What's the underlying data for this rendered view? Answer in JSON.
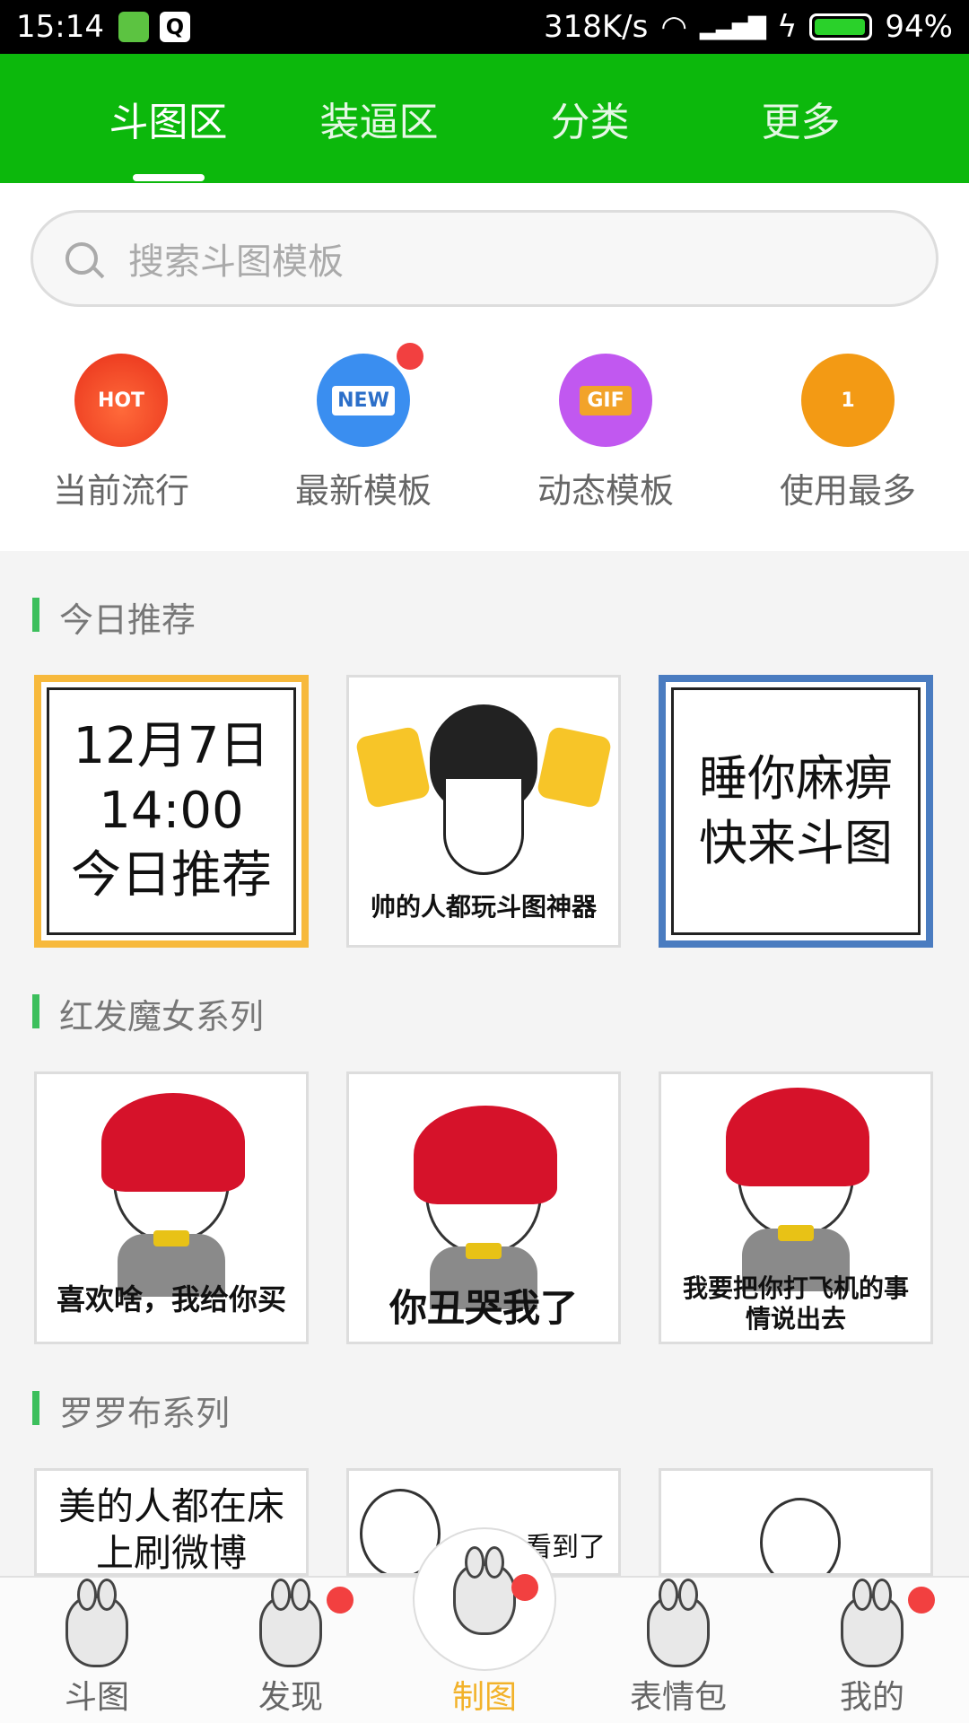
{
  "status_bar": {
    "time": "15:14",
    "network_speed": "318K/s",
    "battery_percent": "94%"
  },
  "top_tabs": [
    {
      "label": "斗图区",
      "active": true
    },
    {
      "label": "装逼区",
      "active": false
    },
    {
      "label": "分类",
      "active": false
    },
    {
      "label": "更多",
      "active": false
    }
  ],
  "search": {
    "placeholder": "搜索斗图模板"
  },
  "categories": [
    {
      "label": "当前流行",
      "icon": "hot-icon",
      "badge": "HOT",
      "color": "#e8301a"
    },
    {
      "label": "最新模板",
      "icon": "new-icon",
      "badge": "NEW",
      "color": "#3a8ef0",
      "has_dot": true
    },
    {
      "label": "动态模板",
      "icon": "gif-icon",
      "badge": "GIF",
      "color": "#c158f0"
    },
    {
      "label": "使用最多",
      "icon": "trophy-icon",
      "badge": "1",
      "color": "#f39a14"
    }
  ],
  "sections": [
    {
      "title": "今日推荐",
      "cards": [
        {
          "caption": "12月7日\n14:00\n今日推荐"
        },
        {
          "caption": "帅的人都玩斗图神器"
        },
        {
          "caption": "睡你麻痹\n快来斗图"
        }
      ]
    },
    {
      "title": "红发魔女系列",
      "cards": [
        {
          "caption": "喜欢啥，我给你买"
        },
        {
          "caption": "你丑哭我了"
        },
        {
          "caption": "我要把你打飞机的事情说出去"
        }
      ]
    },
    {
      "title": "罗罗布系列",
      "cards": [
        {
          "caption": "美的人都在床上刷微博"
        },
        {
          "caption": "看到了"
        },
        {
          "caption": ""
        }
      ]
    }
  ],
  "bottom_nav": [
    {
      "label": "斗图",
      "active": false,
      "has_dot": false
    },
    {
      "label": "发现",
      "active": false,
      "has_dot": true
    },
    {
      "label": "制图",
      "active": true,
      "has_dot": true
    },
    {
      "label": "表情包",
      "active": false,
      "has_dot": false
    },
    {
      "label": "我的",
      "active": false,
      "has_dot": true
    }
  ],
  "colors": {
    "brand_green": "#0cb80c",
    "accent_yellow": "#f2b22a",
    "badge_red": "#f24040"
  }
}
